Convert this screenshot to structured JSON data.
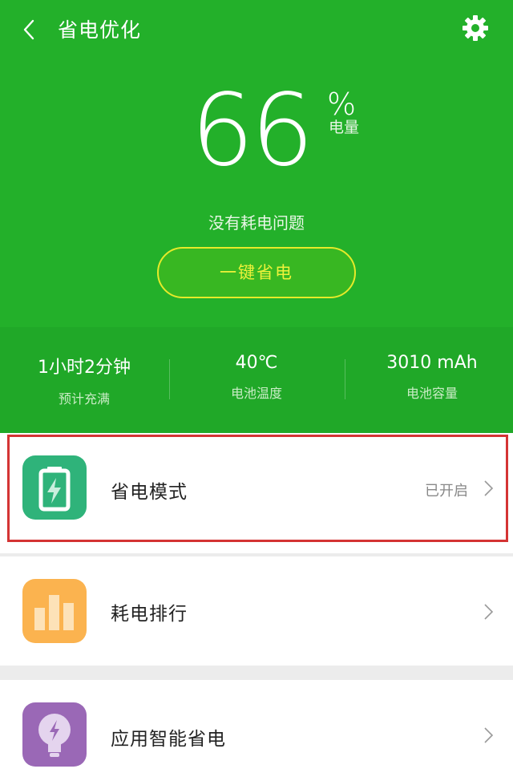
{
  "header": {
    "title": "省电优化"
  },
  "battery": {
    "level": "66",
    "unit": "%",
    "unit_label": "电量",
    "status": "没有耗电问题",
    "action_label": "一键省电"
  },
  "stats": [
    {
      "value": "1小时2分钟",
      "label": "预计充满"
    },
    {
      "value": "40℃",
      "label": "电池温度"
    },
    {
      "value": "3010 mAh",
      "label": "电池容量"
    }
  ],
  "menu": [
    {
      "label": "省电模式",
      "state": "已开启",
      "icon": "battery-charging-icon",
      "color": "#2fb37a"
    },
    {
      "label": "耗电排行",
      "state": "",
      "icon": "bar-chart-icon",
      "color": "#fbb34f"
    },
    {
      "label": "应用智能省电",
      "state": "",
      "icon": "lightbulb-icon",
      "color": "#9a68b6"
    }
  ]
}
